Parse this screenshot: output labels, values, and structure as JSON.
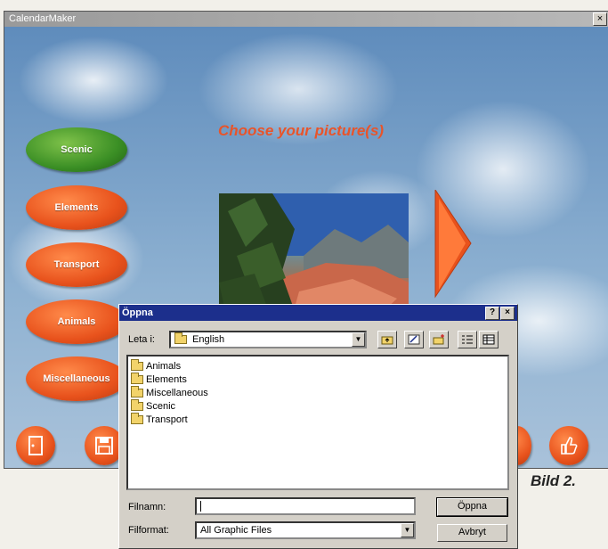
{
  "window": {
    "title": "CalendarMaker",
    "close": "×"
  },
  "main": {
    "heading": "Choose your picture(s)",
    "categories": [
      "Scenic",
      "Elements",
      "Transport",
      "Animals",
      "Miscellaneous"
    ],
    "selected_category": "Scenic"
  },
  "dialog": {
    "title": "Öppna",
    "help": "?",
    "close": "×",
    "look_in_label": "Leta i:",
    "look_in_value": "English",
    "folders": [
      "Animals",
      "Elements",
      "Miscellaneous",
      "Scenic",
      "Transport"
    ],
    "filename_label": "Filnamn:",
    "filename_value": "",
    "filetype_label": "Filformat:",
    "filetype_value": "All Graphic Files",
    "open_button": "Öppna",
    "cancel_button": "Avbryt"
  },
  "caption": "Bild 2.",
  "colors": {
    "accent": "#e8521c",
    "selected": "#3b8f25",
    "dialog_title": "#1c2f8c"
  }
}
